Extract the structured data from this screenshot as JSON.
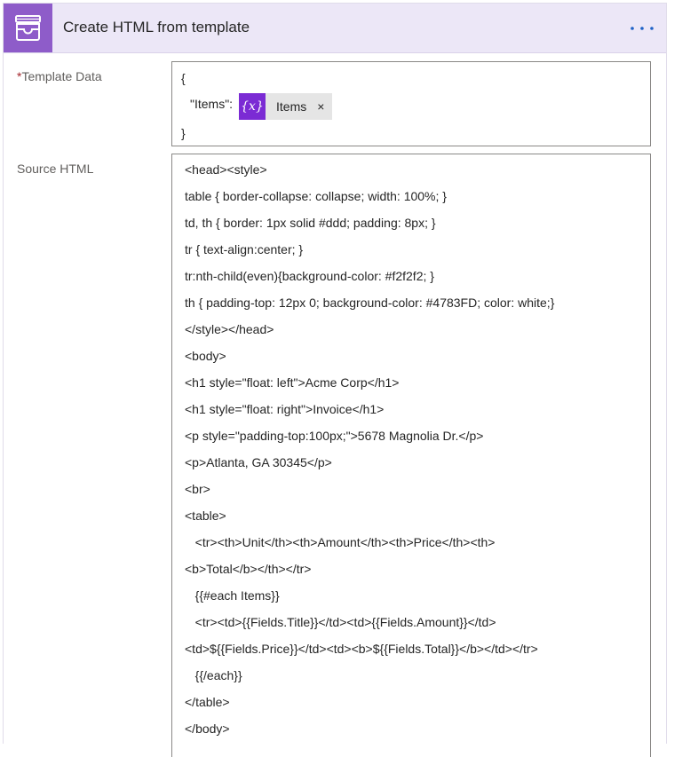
{
  "header": {
    "title": "Create HTML from template",
    "app_icon": "archive-box-icon",
    "more_icon": "ellipsis-icon",
    "accent_color": "#8e5cc9"
  },
  "template_data": {
    "required_mark": "*",
    "label": "Template Data",
    "open_brace": "{",
    "key": "\"Items\":",
    "token": {
      "icon_text": "{x}",
      "label": "Items",
      "remove": "×",
      "icon_color": "#7b2bd4"
    },
    "close_brace": "}"
  },
  "source_html": {
    "label": "Source HTML",
    "lines": [
      "<head><style>",
      "table { border-collapse: collapse; width: 100%; }",
      "td, th { border: 1px solid #ddd; padding: 8px; }",
      "tr { text-align:center; }",
      "tr:nth-child(even){background-color: #f2f2f2; }",
      "th { padding-top: 12px 0; background-color: #4783FD; color: white;}",
      "</style></head>",
      "<body>",
      "<h1 style=\"float: left\">Acme Corp</h1>",
      "<h1 style=\"float: right\">Invoice</h1>",
      "<p style=\"padding-top:100px;\">5678 Magnolia Dr.</p>",
      "<p>Atlanta, GA 30345</p>",
      "<br>",
      "<table>",
      "   <tr><th>Unit</th><th>Amount</th><th>Price</th><th>",
      "<b>Total</b></th></tr>",
      "   {{#each Items}}",
      "   <tr><td>{{Fields.Title}}</td><td>{{Fields.Amount}}</td>",
      "<td>${{Fields.Price}}</td><td><b>${{Fields.Total}}</b></td></tr>",
      "   {{/each}}",
      "</table>",
      "</body>"
    ]
  }
}
